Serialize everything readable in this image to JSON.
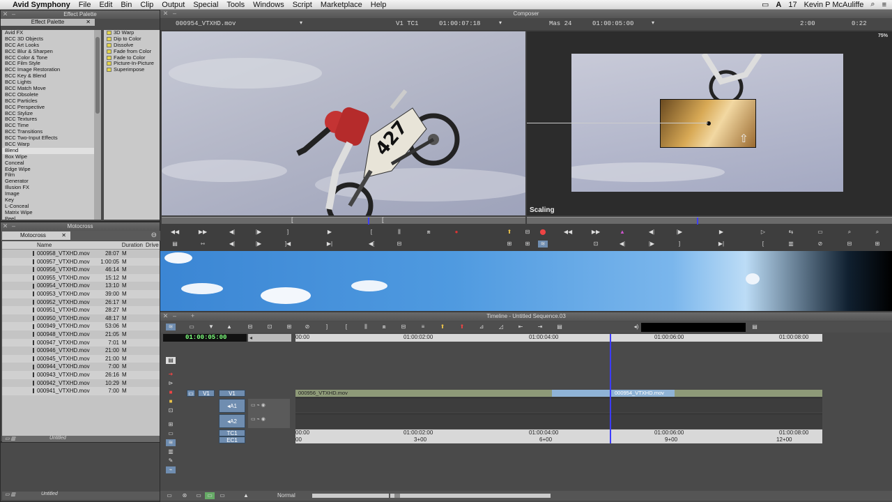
{
  "menubar": {
    "apple": "",
    "app": "Avid Symphony",
    "items": [
      "File",
      "Edit",
      "Bin",
      "Clip",
      "Output",
      "Special",
      "Tools",
      "Windows",
      "Script",
      "Marketplace",
      "Help"
    ],
    "battery": "17",
    "user": "Kevin P McAuliffe"
  },
  "effect_palette": {
    "title": "Effect Palette",
    "categories": [
      "Avid FX",
      "BCC 3D Objects",
      "BCC Art Looks",
      "BCC Blur & Sharpen",
      "BCC Color & Tone",
      "BCC Film Style",
      "BCC Image Restoration",
      "BCC Key & Blend",
      "BCC Lights",
      "BCC Match Move",
      "BCC Obsolete",
      "BCC Particles",
      "BCC Perspective",
      "BCC Stylize",
      "BCC Textures",
      "BCC Time",
      "BCC Transitions",
      "BCC Two-Input Effects",
      "BCC Warp",
      "Blend",
      "Box Wipe",
      "Conceal",
      "Edge Wipe",
      "Film",
      "Generator",
      "Illusion FX",
      "Image",
      "Key",
      "L-Conceal",
      "Matrix Wipe",
      "Peel"
    ],
    "effects": [
      "3D Warp",
      "Dip to Color",
      "Dissolve",
      "Fade from Color",
      "Fade to Color",
      "Picture-In-Picture",
      "Superimpose"
    ]
  },
  "bin": {
    "title": "Motocross",
    "tab": "Motocross",
    "columns": [
      "Name",
      "Duration",
      "Drive"
    ],
    "rows": [
      {
        "name": "000958_VTXHD.mov",
        "duration": "28:07",
        "drive": "M"
      },
      {
        "name": "000957_VTXHD.mov",
        "duration": "1:00:05",
        "drive": "M"
      },
      {
        "name": "000956_VTXHD.mov",
        "duration": "46:14",
        "drive": "M"
      },
      {
        "name": "000955_VTXHD.mov",
        "duration": "15:12",
        "drive": "M"
      },
      {
        "name": "000954_VTXHD.mov",
        "duration": "13:10",
        "drive": "M"
      },
      {
        "name": "000953_VTXHD.mov",
        "duration": "39:00",
        "drive": "M"
      },
      {
        "name": "000952_VTXHD.mov",
        "duration": "26:17",
        "drive": "M"
      },
      {
        "name": "000951_VTXHD.mov",
        "duration": "28:27",
        "drive": "M"
      },
      {
        "name": "000950_VTXHD.mov",
        "duration": "48:17",
        "drive": "M"
      },
      {
        "name": "000949_VTXHD.mov",
        "duration": "53:06",
        "drive": "M"
      },
      {
        "name": "000948_VTXHD.mov",
        "duration": "21:05",
        "drive": "M"
      },
      {
        "name": "000947_VTXHD.mov",
        "duration": "7:01",
        "drive": "M"
      },
      {
        "name": "000946_VTXHD.mov",
        "duration": "21:00",
        "drive": "M"
      },
      {
        "name": "000945_VTXHD.mov",
        "duration": "21:00",
        "drive": "M"
      },
      {
        "name": "000944_VTXHD.mov",
        "duration": "7:00",
        "drive": "M"
      },
      {
        "name": "000943_VTXHD.mov",
        "duration": "26:16",
        "drive": "M"
      },
      {
        "name": "000942_VTXHD.mov",
        "duration": "10:29",
        "drive": "M"
      },
      {
        "name": "000941_VTXHD.mov",
        "duration": "7:00",
        "drive": "M"
      }
    ],
    "view": "Untitled",
    "view2": "Untitled"
  },
  "composer": {
    "title": "Composer",
    "source_clip": "000954_VTXHD.mov",
    "source_track": "V1 TC1",
    "source_tc": "01:00:07:18",
    "record_label": "Mas 24",
    "record_tc": "01:00:05:00",
    "dur1": "2:00",
    "dur2": "0:22",
    "zoom": "75%",
    "effect_mode": "Scaling"
  },
  "timeline": {
    "title": "Timeline - Untitled Sequence.03",
    "timecode": "01:00:05:00",
    "ruler_labels": [
      "00:00",
      "01:00:02:00",
      "01:00:04:00",
      "01:00:06:00",
      "01:00:08:00"
    ],
    "tracks": [
      "V1",
      "A1",
      "A2",
      "TC1",
      "EC1"
    ],
    "clip_a": "000956_VTXHD.mov",
    "clip_b": "000954_VTXHD.mov",
    "tc_labels": [
      "00:00",
      "01:00:02:00",
      "01:00:04:00",
      "01:00:06:00",
      "01:00:08:00"
    ],
    "ec_labels": [
      "00",
      "3+00",
      "6+00",
      "9+00",
      "12+00"
    ],
    "mode": "Normal",
    "record_track": "V1"
  },
  "colors": {
    "clip_green": "#8e9a78",
    "clip_blue": "#8fb3d6",
    "playhead": "#3c3cff",
    "tc_green": "#7cff7c"
  }
}
